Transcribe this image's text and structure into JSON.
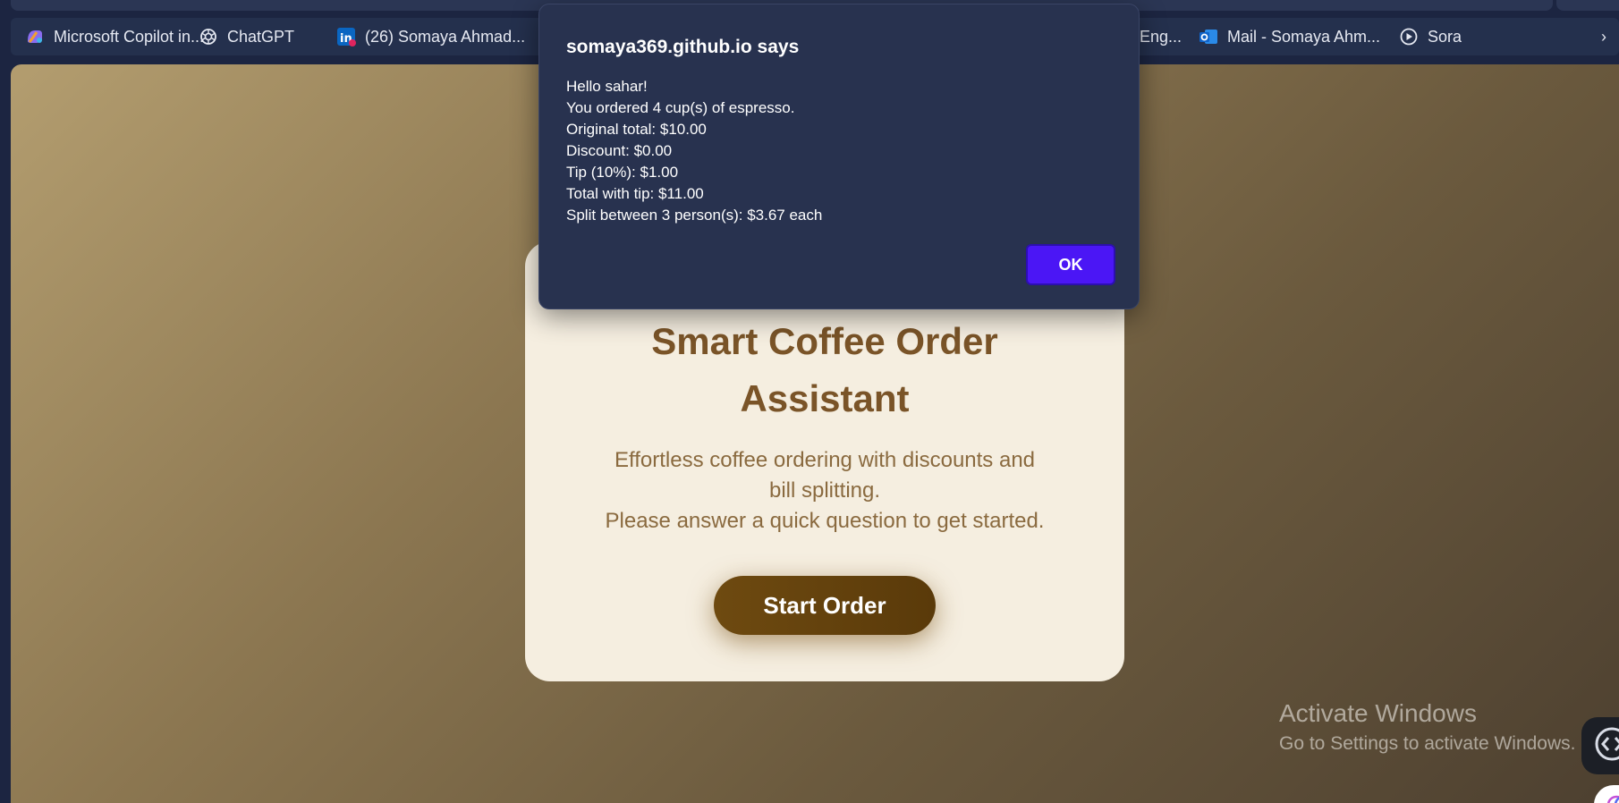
{
  "bookmarks": [
    {
      "label": "Microsoft Copilot in...",
      "icon": "copilot-icon"
    },
    {
      "label": "ChatGPT",
      "icon": "chatgpt-icon"
    },
    {
      "label": "(26) Somaya Ahmad...",
      "icon": "linkedin-icon"
    },
    {
      "label": "Eng...",
      "icon": "generic-icon"
    },
    {
      "label": "Mail - Somaya Ahm...",
      "icon": "outlook-icon"
    },
    {
      "label": "Sora",
      "icon": "sora-icon"
    }
  ],
  "bookmarks_overflow": "›",
  "card": {
    "title_line1": "Smart Coffee Order",
    "title_line2": "Assistant",
    "subtitle_line1": "Effortless coffee ordering with discounts and",
    "subtitle_line2": "bill splitting.",
    "subtitle_line3": "Please answer a quick question to get started.",
    "start_button": "Start Order"
  },
  "dialog": {
    "title": "somaya369.github.io says",
    "lines": [
      "Hello sahar!",
      "You ordered 4 cup(s) of espresso.",
      "Original total: $10.00",
      "Discount: $0.00",
      "Tip (10%): $1.00",
      "Total with tip: $11.00",
      "Split between 3 person(s): $3.67 each"
    ],
    "ok_label": "OK"
  },
  "watermark": {
    "line1": "Activate Windows",
    "line2": "Go to Settings to activate Windows."
  },
  "colors": {
    "accent": "#4b16f5",
    "card_title": "#7a5428",
    "button": "#6e4a10"
  }
}
